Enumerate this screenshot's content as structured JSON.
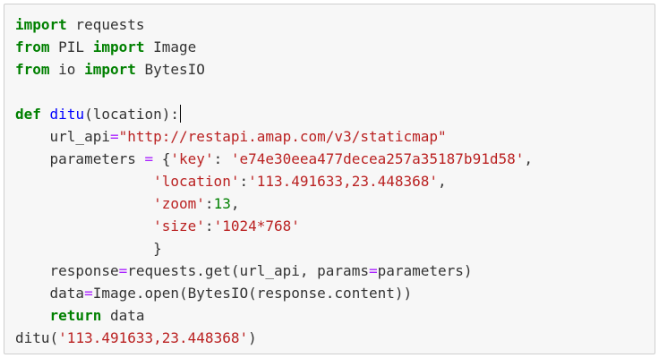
{
  "cell": {
    "kind": "code",
    "language": "python",
    "lines": [
      {
        "tokens": [
          {
            "text": "import",
            "cls": "kw"
          },
          {
            "text": " requests",
            "cls": "plain"
          }
        ]
      },
      {
        "tokens": [
          {
            "text": "from",
            "cls": "kw"
          },
          {
            "text": " PIL ",
            "cls": "plain"
          },
          {
            "text": "import",
            "cls": "kw"
          },
          {
            "text": " Image",
            "cls": "plain"
          }
        ]
      },
      {
        "tokens": [
          {
            "text": "from",
            "cls": "kw"
          },
          {
            "text": " io ",
            "cls": "plain"
          },
          {
            "text": "import",
            "cls": "kw"
          },
          {
            "text": " BytesIO",
            "cls": "plain"
          }
        ]
      },
      {
        "tokens": []
      },
      {
        "tokens": [
          {
            "text": "def",
            "cls": "kw"
          },
          {
            "text": " ",
            "cls": "plain"
          },
          {
            "text": "ditu",
            "cls": "fn"
          },
          {
            "text": "(location):",
            "cls": "plain"
          }
        ],
        "caret": true
      },
      {
        "tokens": [
          {
            "text": "    url_api",
            "cls": "plain"
          },
          {
            "text": "=",
            "cls": "op"
          },
          {
            "text": "\"http://restapi.amap.com/v3/staticmap\"",
            "cls": "str"
          }
        ]
      },
      {
        "tokens": [
          {
            "text": "    parameters ",
            "cls": "plain"
          },
          {
            "text": "=",
            "cls": "op"
          },
          {
            "text": " {",
            "cls": "plain"
          },
          {
            "text": "'key'",
            "cls": "str"
          },
          {
            "text": ": ",
            "cls": "plain"
          },
          {
            "text": "'e74e30eea477decea257a35187b91d58'",
            "cls": "str"
          },
          {
            "text": ",",
            "cls": "plain"
          }
        ]
      },
      {
        "tokens": [
          {
            "text": "                ",
            "cls": "plain"
          },
          {
            "text": "'location'",
            "cls": "str"
          },
          {
            "text": ":",
            "cls": "plain"
          },
          {
            "text": "'113.491633,23.448368'",
            "cls": "str"
          },
          {
            "text": ",",
            "cls": "plain"
          }
        ]
      },
      {
        "tokens": [
          {
            "text": "                ",
            "cls": "plain"
          },
          {
            "text": "'zoom'",
            "cls": "str"
          },
          {
            "text": ":",
            "cls": "plain"
          },
          {
            "text": "13",
            "cls": "num"
          },
          {
            "text": ",",
            "cls": "plain"
          }
        ]
      },
      {
        "tokens": [
          {
            "text": "                ",
            "cls": "plain"
          },
          {
            "text": "'size'",
            "cls": "str"
          },
          {
            "text": ":",
            "cls": "plain"
          },
          {
            "text": "'1024*768'",
            "cls": "str"
          }
        ]
      },
      {
        "tokens": [
          {
            "text": "                }",
            "cls": "plain"
          }
        ]
      },
      {
        "tokens": [
          {
            "text": "    response",
            "cls": "plain"
          },
          {
            "text": "=",
            "cls": "op"
          },
          {
            "text": "requests.get(url_api, params",
            "cls": "plain"
          },
          {
            "text": "=",
            "cls": "op"
          },
          {
            "text": "parameters)",
            "cls": "plain"
          }
        ]
      },
      {
        "tokens": [
          {
            "text": "    data",
            "cls": "plain"
          },
          {
            "text": "=",
            "cls": "op"
          },
          {
            "text": "Image.open(BytesIO(response.content))",
            "cls": "plain"
          }
        ]
      },
      {
        "tokens": [
          {
            "text": "    ",
            "cls": "plain"
          },
          {
            "text": "return",
            "cls": "kw"
          },
          {
            "text": " data",
            "cls": "plain"
          }
        ]
      },
      {
        "tokens": [
          {
            "text": "ditu(",
            "cls": "plain"
          },
          {
            "text": "'113.491633,23.448368'",
            "cls": "str"
          },
          {
            "text": ")",
            "cls": "plain"
          }
        ]
      }
    ]
  },
  "colors": {
    "keyword": "#008000",
    "function": "#0000ff",
    "string": "#ba2121",
    "number": "#008000",
    "operator": "#aa22ff",
    "cell_background": "#f7f7f7",
    "cell_border": "#cfcfcf"
  }
}
